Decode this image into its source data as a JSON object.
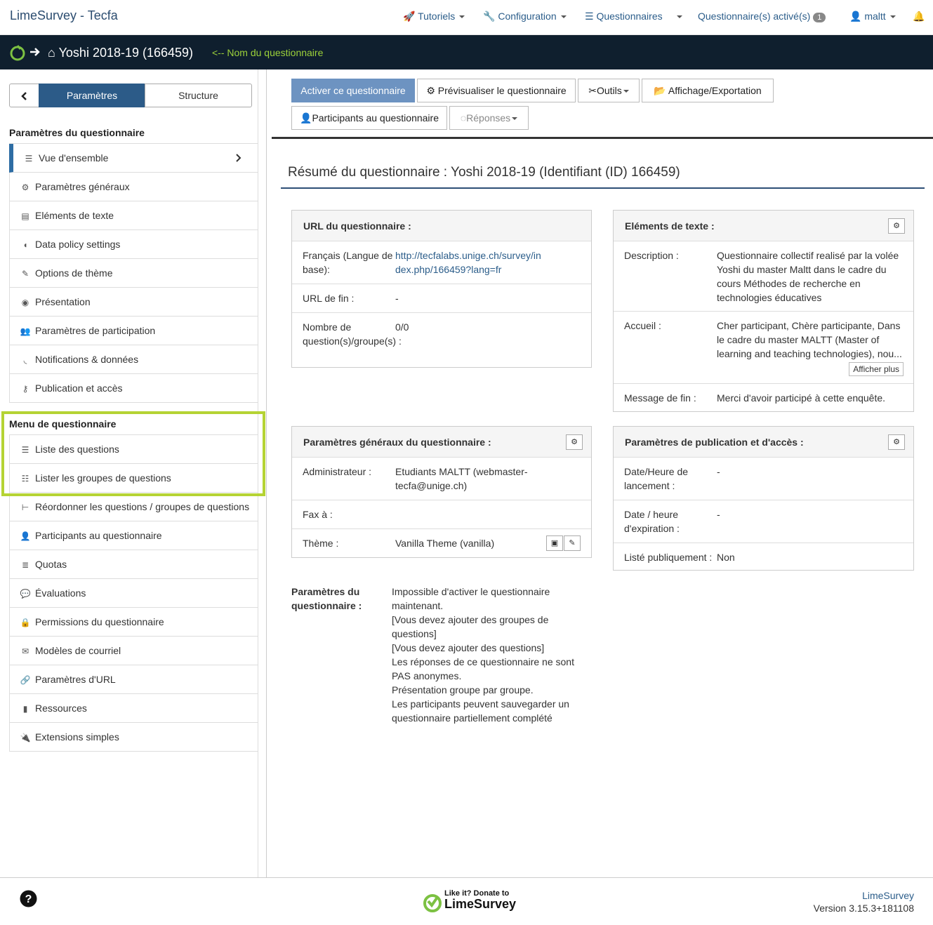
{
  "topnav": {
    "brand": "LimeSurvey - Tecfa",
    "tutorials": "Tutoriels",
    "configuration": "Configuration",
    "surveys": "Questionnaires",
    "active_surveys": "Questionnaire(s) activé(s)",
    "active_count": "1",
    "user": "maltt"
  },
  "surveybar": {
    "title": "Yoshi 2018-19 (166459)",
    "annotation": "<-- Nom du questionnaire"
  },
  "sidebar": {
    "tabs": [
      "Paramètres",
      "Structure"
    ],
    "section1": "Paramètres du questionnaire",
    "items1": [
      {
        "label": "Vue d'ensemble",
        "icon": "list-icon"
      },
      {
        "label": "Paramètres généraux",
        "icon": "cogs-icon"
      },
      {
        "label": "Eléments de texte",
        "icon": "file-text-icon"
      },
      {
        "label": "Data policy settings",
        "icon": "shield-icon"
      },
      {
        "label": "Options de thème",
        "icon": "paint-brush-icon"
      },
      {
        "label": "Présentation",
        "icon": "eye-slash-icon"
      },
      {
        "label": "Paramètres de participation",
        "icon": "users-icon"
      },
      {
        "label": "Notifications & données",
        "icon": "rss-icon"
      },
      {
        "label": "Publication et accès",
        "icon": "key-icon"
      }
    ],
    "section2": "Menu de questionnaire",
    "items2": [
      {
        "label": "Liste des questions",
        "icon": "list-icon"
      },
      {
        "label": "Lister les groupes de questions",
        "icon": "th-list-icon"
      },
      {
        "label": "Réordonner les questions / groupes de questions",
        "icon": "sitemap-icon"
      },
      {
        "label": "Participants au questionnaire",
        "icon": "user-icon"
      },
      {
        "label": "Quotas",
        "icon": "tasks-icon"
      },
      {
        "label": "Évaluations",
        "icon": "comment-icon"
      },
      {
        "label": "Permissions du questionnaire",
        "icon": "lock-icon"
      },
      {
        "label": "Modèles de courriel",
        "icon": "envelope-icon"
      },
      {
        "label": "Paramètres d'URL",
        "icon": "link-icon"
      },
      {
        "label": "Ressources",
        "icon": "file-icon"
      },
      {
        "label": "Extensions simples",
        "icon": "plug-icon"
      }
    ]
  },
  "toolbar": {
    "activate": "Activer ce questionnaire",
    "preview": "Prévisualiser le questionnaire",
    "tools": "Outils",
    "display_export": "Affichage/Exportation",
    "participants": "Participants au questionnaire",
    "responses": "Réponses"
  },
  "summary": {
    "title": "Résumé du questionnaire : Yoshi 2018-19 (Identifiant (ID) 166459)",
    "url_panel": {
      "header": "URL du questionnaire :",
      "lang_label": "Français (Langue de base):",
      "lang_url": "http://tecfalabs.unige.ch/survey/index.php/166459?lang=fr",
      "end_url_label": "URL de fin :",
      "end_url_value": "-",
      "count_label": "Nombre de question(s)/groupe(s) :",
      "count_value": "0/0"
    },
    "text_panel": {
      "header": "Eléments de texte :",
      "desc_label": "Description :",
      "desc_value": "Questionnaire collectif realisé par la volée Yoshi du master Maltt dans le cadre du cours Méthodes de recherche en technologies éducatives",
      "welcome_label": "Accueil :",
      "welcome_value": "Cher participant, Chère participante, Dans le cadre du master MALTT (Master of learning and teaching technologies), nou...",
      "show_more": "Afficher plus",
      "end_label": "Message de fin :",
      "end_value": "Merci d'avoir participé à cette enquête."
    },
    "general_panel": {
      "header": "Paramètres généraux du questionnaire :",
      "admin_label": "Administrateur :",
      "admin_value": "Etudiants MALTT (webmaster-tecfa@unige.ch)",
      "fax_label": "Fax à :",
      "fax_value": "",
      "theme_label": "Thème :",
      "theme_value": "Vanilla Theme (vanilla)"
    },
    "publication_panel": {
      "header": "Paramètres de publication et d'accès :",
      "start_label": "Date/Heure de lancement :",
      "start_value": "-",
      "expiry_label": "Date / heure d'expiration :",
      "expiry_value": "-",
      "listed_label": "Listé publiquement :",
      "listed_value": "Non"
    },
    "settings": {
      "label": "Paramètres du questionnaire :",
      "lines": [
        "Impossible d'activer le questionnaire maintenant.",
        "[Vous devez ajouter des groupes de questions]",
        "[Vous devez ajouter des questions]",
        "Les réponses de ce questionnaire ne sont PAS anonymes.",
        "Présentation groupe par groupe.",
        "Les participants peuvent sauvegarder un questionnaire partiellement complété"
      ]
    }
  },
  "footer": {
    "donate_line1": "Like it? Donate to",
    "donate_line2": "LimeSurvey",
    "brand_link": "LimeSurvey",
    "version": "Version 3.15.3+181108"
  },
  "colors": {
    "accent": "#2e6da4",
    "dark_bar": "#0f1f2e",
    "highlight": "#b5d334",
    "lime": "#7cc142"
  }
}
